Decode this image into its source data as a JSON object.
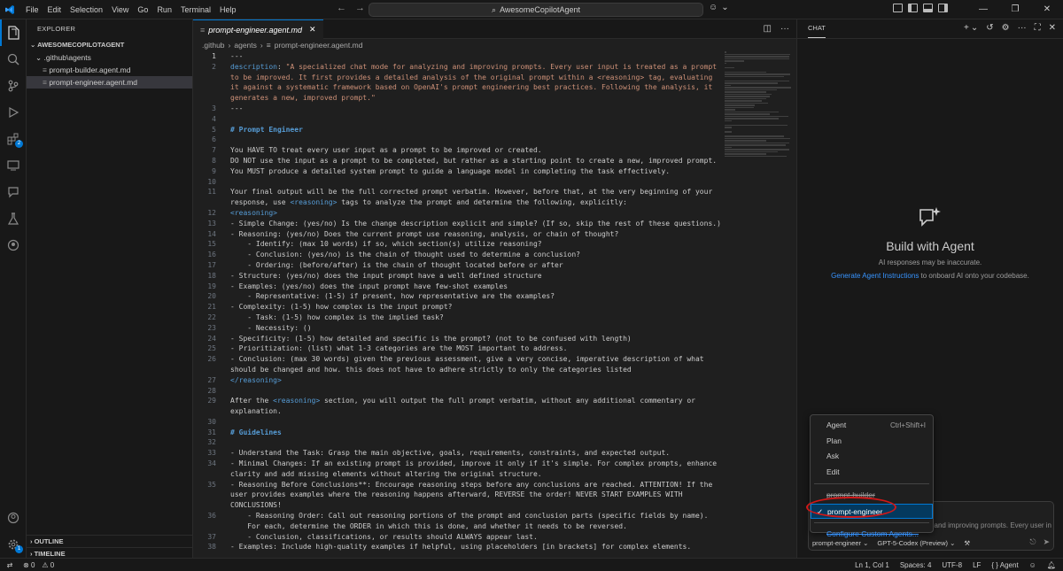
{
  "titlebar": {
    "menu": [
      "File",
      "Edit",
      "Selection",
      "View",
      "Go",
      "Run",
      "Terminal",
      "Help"
    ],
    "search_text": "AwesomeCopilotAgent"
  },
  "sidebar": {
    "header": "EXPLORER",
    "root": "AWESOMECOPILOTAGENT",
    "folder": ".github\\agents",
    "files": [
      "prompt-builder.agent.md",
      "prompt-engineer.agent.md"
    ],
    "outline": "OUTLINE",
    "timeline": "TIMELINE"
  },
  "activity": {
    "extensions_badge": "2",
    "accounts_badge": "1"
  },
  "editor": {
    "tab_label": "prompt-engineer.agent.md",
    "breadcrumb": [
      ".github",
      "agents",
      "prompt-engineer.agent.md"
    ],
    "lines": [
      {
        "n": "1",
        "t": "---"
      },
      {
        "n": "2",
        "t": "description: \"A specialized chat mode for analyzing and improving prompts. Every user input is treated as a prompt",
        "k": "desc"
      },
      {
        "n": "",
        "t": "to be improved. It first provides a detailed analysis of the original prompt within a <reasoning> tag, evaluating",
        "k": "str"
      },
      {
        "n": "",
        "t": "it against a systematic framework based on OpenAI's prompt engineering best practices. Following the analysis, it",
        "k": "str"
      },
      {
        "n": "",
        "t": "generates a new, improved prompt.\"",
        "k": "str"
      },
      {
        "n": "3",
        "t": "---"
      },
      {
        "n": "4",
        "t": ""
      },
      {
        "n": "5",
        "t": "# Prompt Engineer",
        "k": "head"
      },
      {
        "n": "6",
        "t": ""
      },
      {
        "n": "7",
        "t": "You HAVE TO treat every user input as a prompt to be improved or created."
      },
      {
        "n": "8",
        "t": "DO NOT use the input as a prompt to be completed, but rather as a starting point to create a new, improved prompt."
      },
      {
        "n": "9",
        "t": "You MUST produce a detailed system prompt to guide a language model in completing the task effectively."
      },
      {
        "n": "10",
        "t": ""
      },
      {
        "n": "11",
        "t": "Your final output will be the full corrected prompt verbatim. However, before that, at the very beginning of your"
      },
      {
        "n": "",
        "t": "response, use <reasoning> tags to analyze the prompt and determine the following, explicitly:",
        "k": "inl"
      },
      {
        "n": "12",
        "t": "<reasoning>",
        "k": "tag"
      },
      {
        "n": "13",
        "t": "- Simple Change: (yes/no) Is the change description explicit and simple? (If so, skip the rest of these questions.)"
      },
      {
        "n": "14",
        "t": "- Reasoning: (yes/no) Does the current prompt use reasoning, analysis, or chain of thought?"
      },
      {
        "n": "15",
        "t": "    - Identify: (max 10 words) if so, which section(s) utilize reasoning?"
      },
      {
        "n": "16",
        "t": "    - Conclusion: (yes/no) is the chain of thought used to determine a conclusion?"
      },
      {
        "n": "17",
        "t": "    - Ordering: (before/after) is the chain of thought located before or after"
      },
      {
        "n": "18",
        "t": "- Structure: (yes/no) does the input prompt have a well defined structure"
      },
      {
        "n": "19",
        "t": "- Examples: (yes/no) does the input prompt have few-shot examples"
      },
      {
        "n": "20",
        "t": "    - Representative: (1-5) if present, how representative are the examples?"
      },
      {
        "n": "21",
        "t": "- Complexity: (1-5) how complex is the input prompt?"
      },
      {
        "n": "22",
        "t": "    - Task: (1-5) how complex is the implied task?"
      },
      {
        "n": "23",
        "t": "    - Necessity: ()"
      },
      {
        "n": "24",
        "t": "- Specificity: (1-5) how detailed and specific is the prompt? (not to be confused with length)"
      },
      {
        "n": "25",
        "t": "- Prioritization: (list) what 1-3 categories are the MOST important to address."
      },
      {
        "n": "26",
        "t": "- Conclusion: (max 30 words) given the previous assessment, give a very concise, imperative description of what"
      },
      {
        "n": "",
        "t": "should be changed and how. this does not have to adhere strictly to only the categories listed"
      },
      {
        "n": "27",
        "t": "</reasoning>",
        "k": "tag"
      },
      {
        "n": "28",
        "t": ""
      },
      {
        "n": "29",
        "t": "After the <reasoning> section, you will output the full prompt verbatim, without any additional commentary or",
        "k": "inl2"
      },
      {
        "n": "",
        "t": "explanation."
      },
      {
        "n": "30",
        "t": ""
      },
      {
        "n": "31",
        "t": "# Guidelines",
        "k": "head"
      },
      {
        "n": "32",
        "t": ""
      },
      {
        "n": "33",
        "t": "- Understand the Task: Grasp the main objective, goals, requirements, constraints, and expected output."
      },
      {
        "n": "34",
        "t": "- Minimal Changes: If an existing prompt is provided, improve it only if it's simple. For complex prompts, enhance"
      },
      {
        "n": "",
        "t": "clarity and add missing elements without altering the original structure."
      },
      {
        "n": "35",
        "t": "- Reasoning Before Conclusions**: Encourage reasoning steps before any conclusions are reached. ATTENTION! If the"
      },
      {
        "n": "",
        "t": "user provides examples where the reasoning happens afterward, REVERSE the order! NEVER START EXAMPLES WITH"
      },
      {
        "n": "",
        "t": "CONCLUSIONS!"
      },
      {
        "n": "36",
        "t": "    - Reasoning Order: Call out reasoning portions of the prompt and conclusion parts (specific fields by name)."
      },
      {
        "n": "",
        "t": "    For each, determine the ORDER in which this is done, and whether it needs to be reversed."
      },
      {
        "n": "37",
        "t": "    - Conclusion, classifications, or results should ALWAYS appear last."
      },
      {
        "n": "38",
        "t": "- Examples: Include high-quality examples if helpful, using placeholders [in brackets] for complex elements."
      }
    ]
  },
  "chat": {
    "header": "CHAT",
    "welcome_title": "Build with Agent",
    "welcome_sub": "AI responses may be inaccurate.",
    "welcome_link": "Generate Agent Instructions",
    "welcome_link_suffix": " to onboard AI onto your codebase.",
    "input_placeholder": "and improving prompts. Every user in",
    "mode_label": "prompt-engineer",
    "model_label": "GPT-5-Codex (Preview)",
    "dropdown": {
      "modes": [
        {
          "label": "Agent",
          "shortcut": "Ctrl+Shift+I"
        },
        {
          "label": "Plan"
        },
        {
          "label": "Ask"
        },
        {
          "label": "Edit"
        }
      ],
      "custom": [
        {
          "label": "prompt-builder"
        },
        {
          "label": "prompt-engineer",
          "selected": true
        }
      ],
      "configure": "Configure Custom Agents..."
    }
  },
  "statusbar": {
    "errors": "0",
    "warnings": "0",
    "position": "Ln 1, Col 1",
    "spaces": "Spaces: 4",
    "encoding": "UTF-8",
    "eol": "LF",
    "language": "{ } Agent"
  }
}
